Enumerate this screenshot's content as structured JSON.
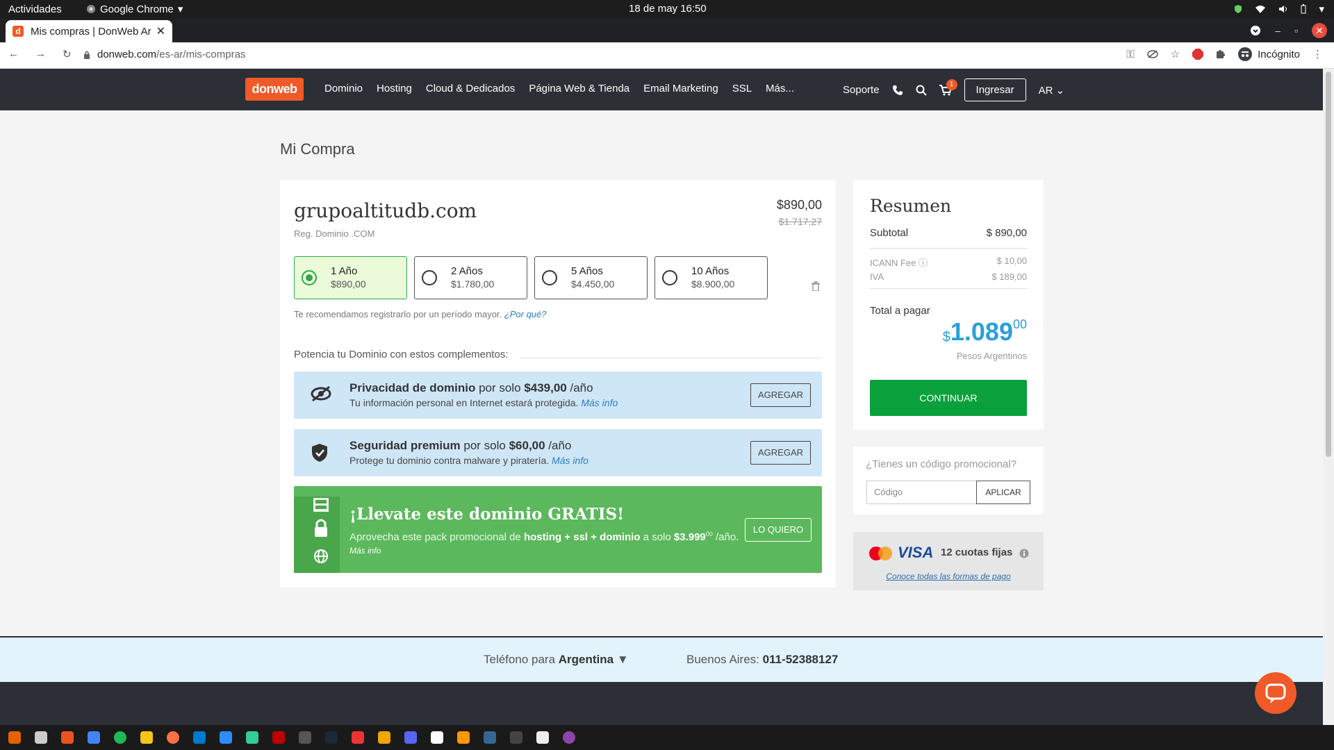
{
  "os": {
    "activities": "Actividades",
    "app_name": "Google Chrome",
    "clock": "18 de may  16:50"
  },
  "browser": {
    "tab_title": "Mis compras | DonWeb Ar",
    "url_host": "donweb.com",
    "url_path": "/es-ar/mis-compras",
    "profile": "Incógnito"
  },
  "site": {
    "logo": "donweb",
    "nav": [
      "Dominio",
      "Hosting",
      "Cloud & Dedicados",
      "Página Web & Tienda",
      "Email Marketing",
      "SSL",
      "Más..."
    ],
    "support": "Soporte",
    "cart_count": "1",
    "login": "Ingresar",
    "country": "AR"
  },
  "page": {
    "title": "Mi Compra",
    "domain": "grupoaltitudb.com",
    "reg_label": "Reg. Dominio .COM",
    "price": "$890,00",
    "old_price": "$1.717,27",
    "years": [
      {
        "label": "1 Año",
        "price": "$890,00",
        "selected": true
      },
      {
        "label": "2 Años",
        "price": "$1.780,00",
        "selected": false
      },
      {
        "label": "5 Años",
        "price": "$4.450,00",
        "selected": false
      },
      {
        "label": "10 Años",
        "price": "$8.900,00",
        "selected": false
      }
    ],
    "recommend": "Te recomendamos registrarlo por un período mayor.",
    "recommend_link": "¿Por qué?",
    "complements": "Potencia tu Dominio con estos complementos:",
    "addons": [
      {
        "name": "Privacidad de dominio",
        "mid": " por solo ",
        "price": "$439,00",
        "per": " /año",
        "desc": "Tu información personal en Internet estará protegida.",
        "more": "Más info",
        "button": "AGREGAR",
        "icon": "eye-off-icon"
      },
      {
        "name": "Seguridad premium",
        "mid": " por solo ",
        "price": "$60,00",
        "per": " /año",
        "desc": "Protege tu dominio contra malware y piratería.",
        "more": "Más info",
        "button": "AGREGAR",
        "icon": "shield-check-icon"
      }
    ],
    "promo": {
      "headline": "¡Llevate este dominio GRATIS!",
      "text_a": "Aprovecha este pack promocional de ",
      "text_b": "hosting + ssl + dominio",
      "text_c": " a solo ",
      "price": "$3.999",
      "price_dec": "00",
      "per": " /año.",
      "more": "Más info",
      "button": "LO QUIERO"
    }
  },
  "summary": {
    "title": "Resumen",
    "subtotal_label": "Subtotal",
    "subtotal": "$ 890,00",
    "icann_label": "ICANN Fee",
    "icann": "$ 10,00",
    "iva_label": "IVA",
    "iva": "$ 189,00",
    "total_label": "Total a pagar",
    "total_currency": "$",
    "total_int": "1.089",
    "total_dec": "00",
    "currency_name": "Pesos Argentinos",
    "continue": "CONTINUAR"
  },
  "promo_code": {
    "question": "¿Tienes un código promocional?",
    "placeholder": "Código",
    "apply": "APLICAR"
  },
  "payment": {
    "visa": "VISA",
    "installments": "12 cuotas fijas",
    "link": "Conoce todas las formas de pago"
  },
  "footer": {
    "phone_label": "Teléfono para ",
    "country": "Argentina",
    "city_label": "Buenos Aires: ",
    "phone": "011-52388127"
  },
  "colors": {
    "brand": "#ef5a28",
    "header": "#2c2f36",
    "accent_blue": "#2a9fd8",
    "continue_green": "#0aa03c",
    "promo_green": "#5cb85c"
  }
}
